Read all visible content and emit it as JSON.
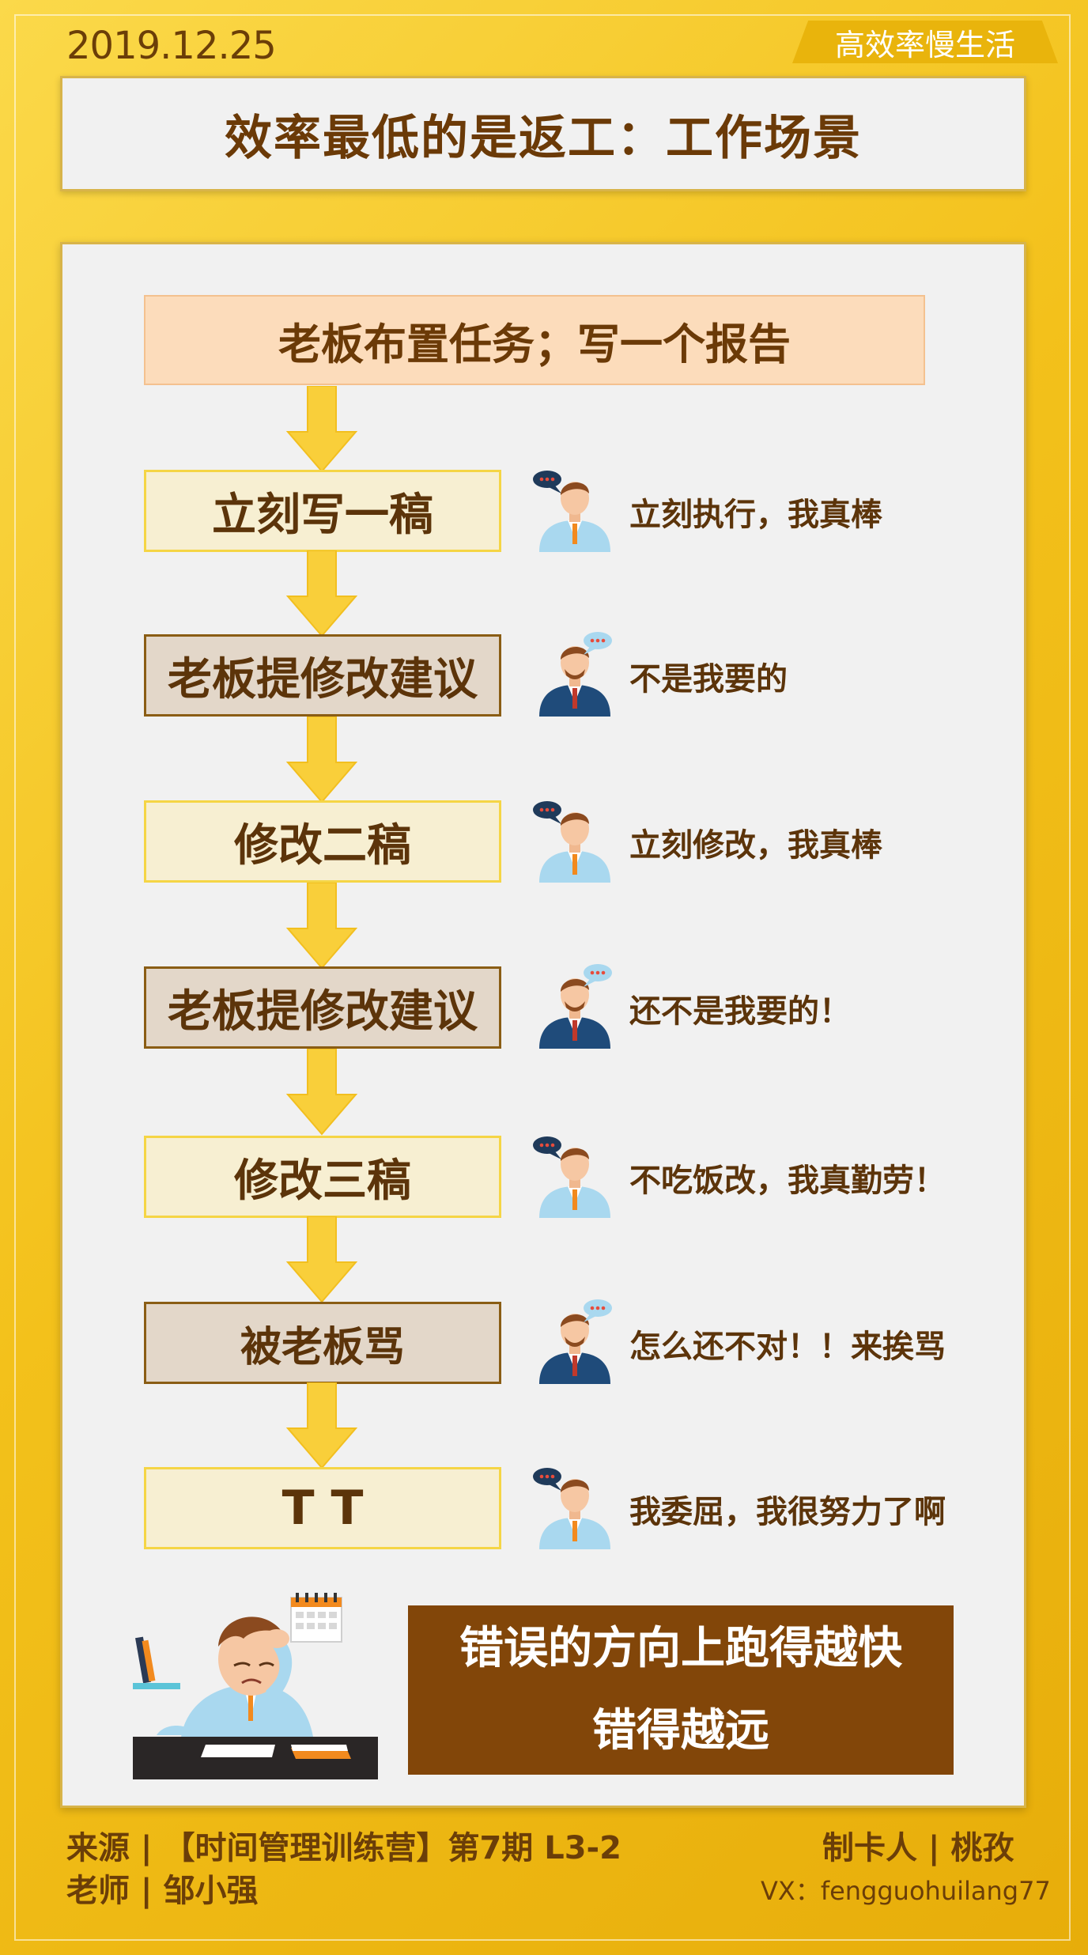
{
  "header": {
    "date": "2019.12.25",
    "tagline": "高效率慢生活",
    "title": "效率最低的是返工：工作场景"
  },
  "task": "老板布置任务；写一个报告",
  "steps": [
    {
      "label": "立刻写一稿",
      "style": "light",
      "speaker": "employee",
      "quote": "立刻执行，我真棒"
    },
    {
      "label": "老板提修改建议",
      "style": "dark",
      "speaker": "boss",
      "quote": "不是我要的"
    },
    {
      "label": "修改二稿",
      "style": "light",
      "speaker": "employee",
      "quote": "立刻修改，我真棒"
    },
    {
      "label": "老板提修改建议",
      "style": "dark",
      "speaker": "boss",
      "quote": "还不是我要的！"
    },
    {
      "label": "修改三稿",
      "style": "light",
      "speaker": "employee",
      "quote": "不吃饭改，我真勤劳！"
    },
    {
      "label": "被老板骂",
      "style": "dark",
      "speaker": "boss",
      "quote": "怎么还不对！！来挨骂"
    },
    {
      "label": "T T",
      "style": "light",
      "speaker": "employee",
      "quote": "我委屈，我很努力了啊"
    }
  ],
  "conclusion": {
    "line1": "错误的方向上跑得越快",
    "line2": "错得越远"
  },
  "footer": {
    "source": "来源 | 【时间管理训练营】第7期  L3-2",
    "teacher": "老师 | 邹小强",
    "maker": "制卡人 | 桃孜",
    "wechat": "VX：fengguohuilang77"
  },
  "icons": [
    "arrow-down-icon",
    "employee-avatar-icon",
    "boss-avatar-icon",
    "speech-bubble-icon",
    "stressed-worker-illustration"
  ],
  "colors": {
    "background": "#f3c11b",
    "title_text": "#6b3a07",
    "step_light_fill": "#f7efd2",
    "step_light_border": "#f5d545",
    "step_dark_fill": "#e3d7c9",
    "step_dark_border": "#8a5d14",
    "task_fill": "#fcdcbb",
    "arrow": "#f9cf3a",
    "conclusion_fill": "#824609"
  }
}
